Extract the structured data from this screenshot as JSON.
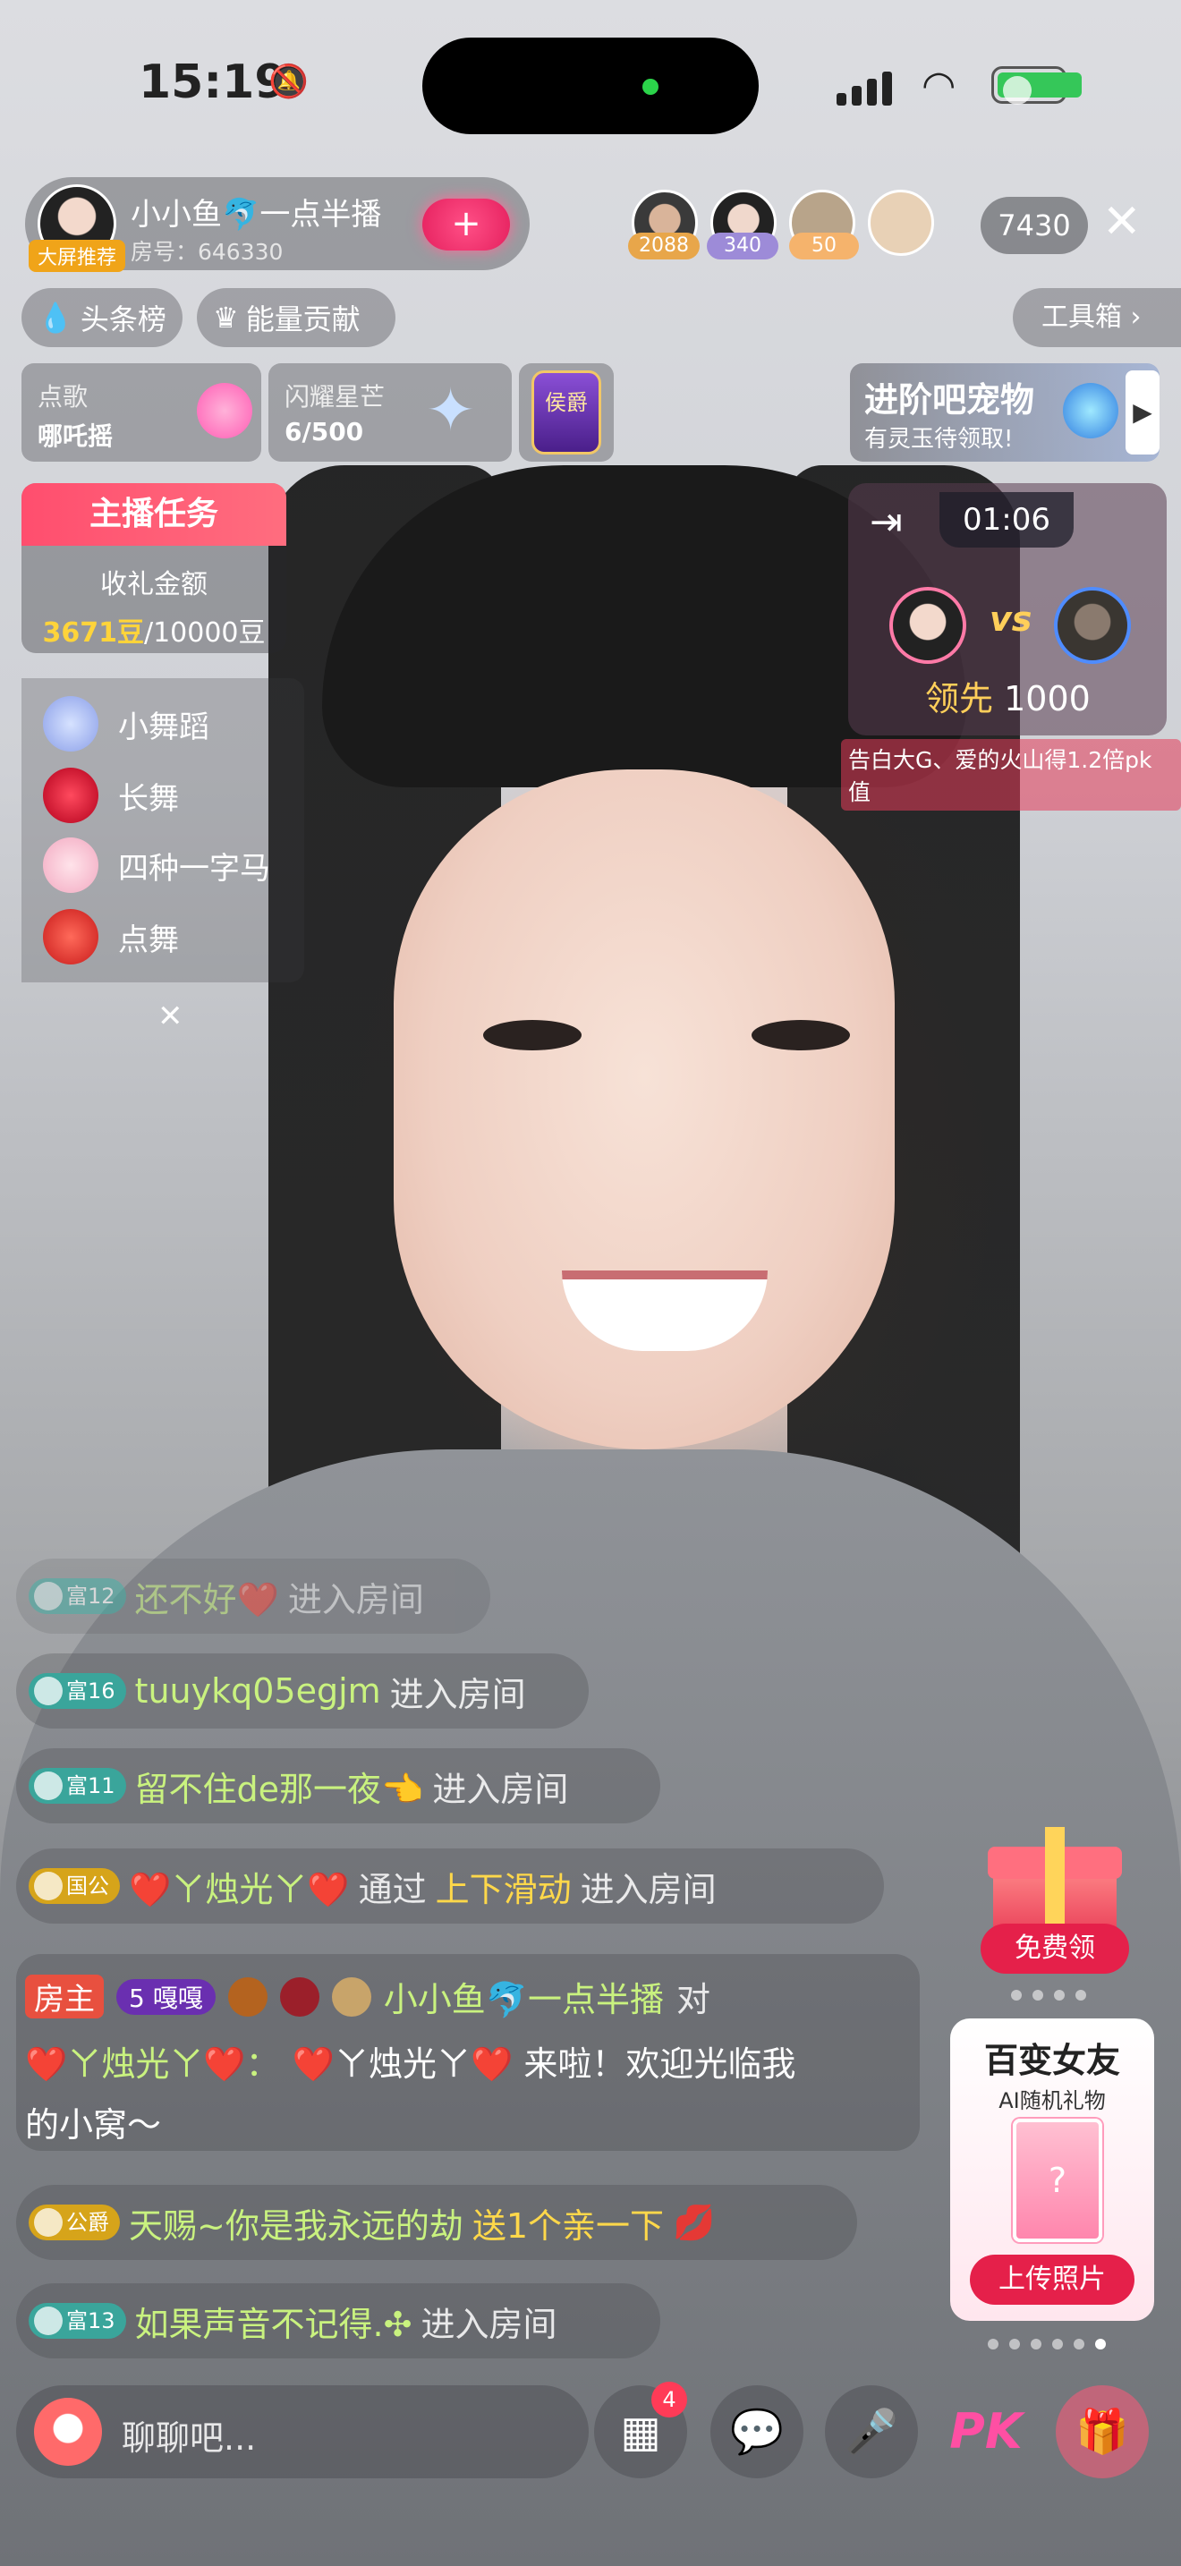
{
  "status_bar": {
    "time": "15:19"
  },
  "host": {
    "badge": "大屏推荐",
    "name": "小小鱼🐬一点半播",
    "room": "房号：646330",
    "follow": "+"
  },
  "viewers": [
    {
      "count": "2088"
    },
    {
      "count": "340"
    },
    {
      "count": "50"
    }
  ],
  "online_count": "7430",
  "pills": {
    "headline": "头条榜",
    "energy": "能量贡献",
    "toolbox": "工具箱 ›"
  },
  "cards": {
    "song_title": "点歌",
    "song_value": "哪吒摇",
    "star_title": "闪耀星芒",
    "star_value": "6/500",
    "rank_badge": "侯爵",
    "pet_title": "进阶吧宠物",
    "pet_sub": "有灵玉待领取!"
  },
  "task": {
    "title": "主播任务",
    "label": "收礼金额",
    "progress": "3671豆",
    "goal": "/10000豆"
  },
  "pk": {
    "timer": "01:06",
    "vs": "vs",
    "lead_label": "领先",
    "lead_value": "1000",
    "tip": "告白大G、爱的火山得1.2倍pk值"
  },
  "dance": [
    "小舞蹈",
    "长舞",
    "四种一字马",
    "点舞"
  ],
  "chat": {
    "l1": {
      "level": "富12",
      "name": "还不好❤️",
      "action": "进入房间"
    },
    "l2": {
      "level": "富16",
      "name": "tuuykq05egjm",
      "action": "进入房间"
    },
    "l3": {
      "level": "富11",
      "name": "留不住de那一夜👈",
      "action": "进入房间"
    },
    "l4": {
      "level": "国公",
      "name": "❤️ㄚ烛光ㄚ❤️",
      "via": "通过",
      "method": "上下滑动",
      "action": "进入房间"
    },
    "block": {
      "role": "房主",
      "fan": "5 嘎嘎",
      "name": "小小鱼🐬一点半播",
      "to": "对",
      "target": "❤️ㄚ烛光ㄚ❤️：",
      "msg1": "❤️ㄚ烛光ㄚ❤️ 来啦！欢迎光临我",
      "msg2": "的小窝～"
    },
    "l5": {
      "level": "公爵",
      "name": "天赐~你是我永远的劫",
      "action": "送1个亲一下"
    },
    "l6": {
      "level": "富13",
      "name": "如果声音不记得.✣",
      "action": "进入房间"
    }
  },
  "side": {
    "free": "免费领",
    "ai_title": "百变女友",
    "ai_sub": "AI随机礼物",
    "ai_btn": "上传照片"
  },
  "bottom": {
    "placeholder": "聊聊吧...",
    "apps_badge": "4",
    "pk": "PK"
  }
}
